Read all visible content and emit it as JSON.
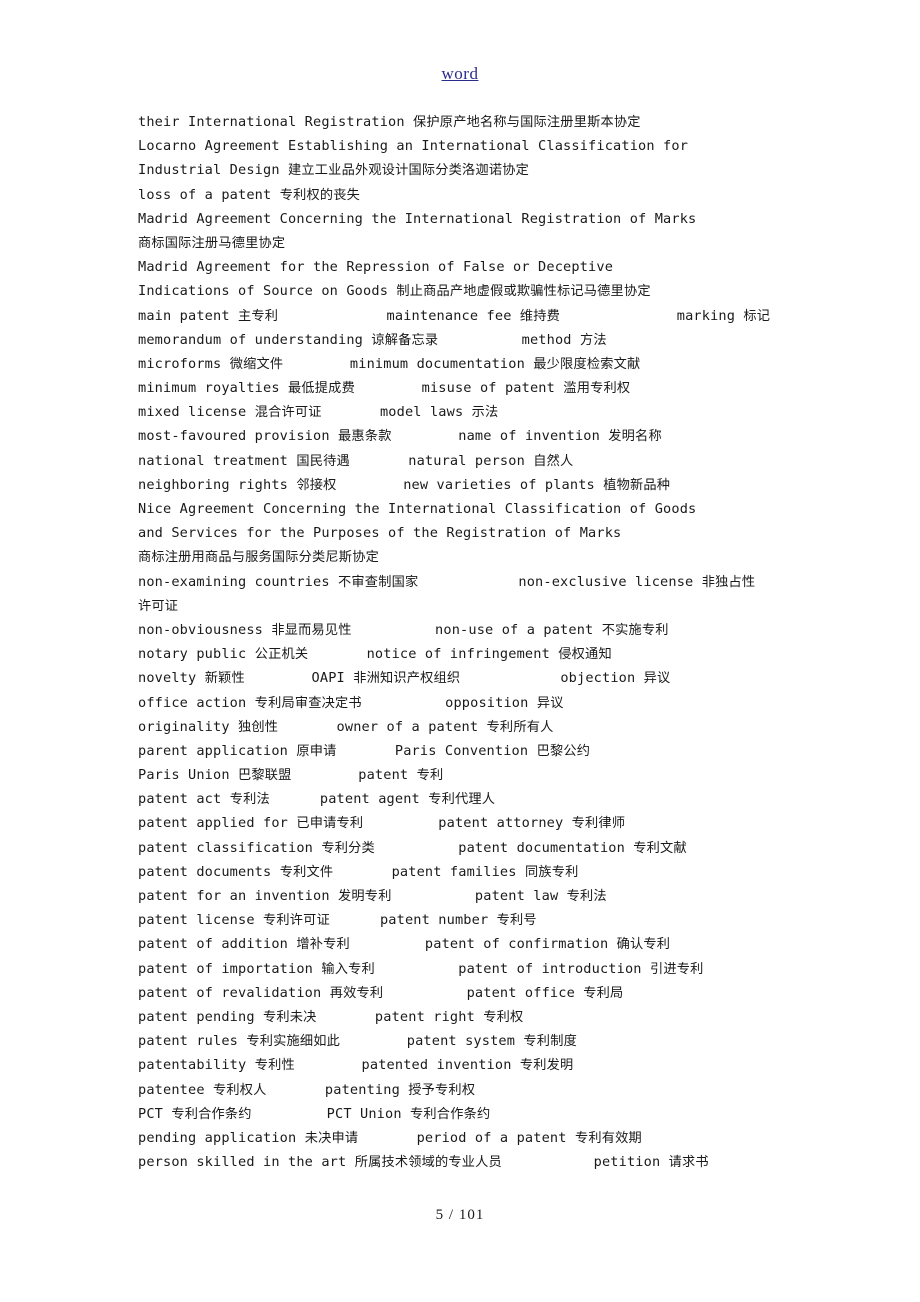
{
  "header": {
    "link_label": "word"
  },
  "footer": {
    "page_label": "5 / 101"
  },
  "document": {
    "lines": [
      "their International Registration 保护原产地名称与国际注册里斯本协定",
      "Locarno Agreement Establishing an International Classification for",
      "Industrial Design 建立工业品外观设计国际分类洛迦诺协定",
      "loss of a patent 专利权的丧失",
      "Madrid Agreement Concerning the International Registration of Marks",
      "商标国际注册马德里协定",
      "Madrid Agreement for the Repression of False or Deceptive",
      "Indications of Source on Goods 制止商品产地虚假或欺骗性标记马德里协定",
      "main patent 主专利             maintenance fee 维持费              marking 标记",
      "memorandum of understanding 谅解备忘录          method 方法",
      "microforms 微缩文件        minimum documentation 最少限度检索文献",
      "minimum royalties 最低提成费        misuse of patent 滥用专利权",
      "mixed license 混合许可证       model laws 示法",
      "most-favoured provision 最惠条款        name of invention 发明名称",
      "national treatment 国民待遇       natural person 自然人",
      "neighboring rights 邻接权        new varieties of plants 植物新品种",
      "Nice Agreement Concerning the International Classification of Goods",
      "and Services for the Purposes of the Registration of Marks",
      "商标注册用商品与服务国际分类尼斯协定",
      "non-examining countries 不审查制国家            non-exclusive license 非独占性",
      "许可证",
      "non-obviousness 非显而易见性          non-use of a patent 不实施专利",
      "notary public 公正机关       notice of infringement 侵权通知",
      "novelty 新颖性        OAPI 非洲知识产权组织            objection 异议",
      "office action 专利局审查决定书          opposition 异议",
      "originality 独创性       owner of a patent 专利所有人",
      "parent application 原申请       Paris Convention 巴黎公约",
      "Paris Union 巴黎联盟        patent 专利",
      "patent act 专利法      patent agent 专利代理人",
      "patent applied for 已申请专利         patent attorney 专利律师",
      "patent classification 专利分类          patent documentation 专利文献",
      "patent documents 专利文件       patent families 同族专利",
      "patent for an invention 发明专利          patent law 专利法",
      "patent license 专利许可证      patent number 专利号",
      "patent of addition 增补专利         patent of confirmation 确认专利",
      "patent of importation 输入专利          patent of introduction 引进专利",
      "patent of revalidation 再效专利          patent office 专利局",
      "patent pending 专利未决       patent right 专利权",
      "patent rules 专利实施细如此        patent system 专利制度",
      "patentability 专利性        patented invention 专利发明",
      "patentee 专利权人       patenting 授予专利权",
      "PCT 专利合作条约         PCT Union 专利合作条约",
      "pending application 未决申请       period of a patent 专利有效期",
      "person skilled in the art 所属技术领域的专业人员           petition 请求书"
    ]
  }
}
